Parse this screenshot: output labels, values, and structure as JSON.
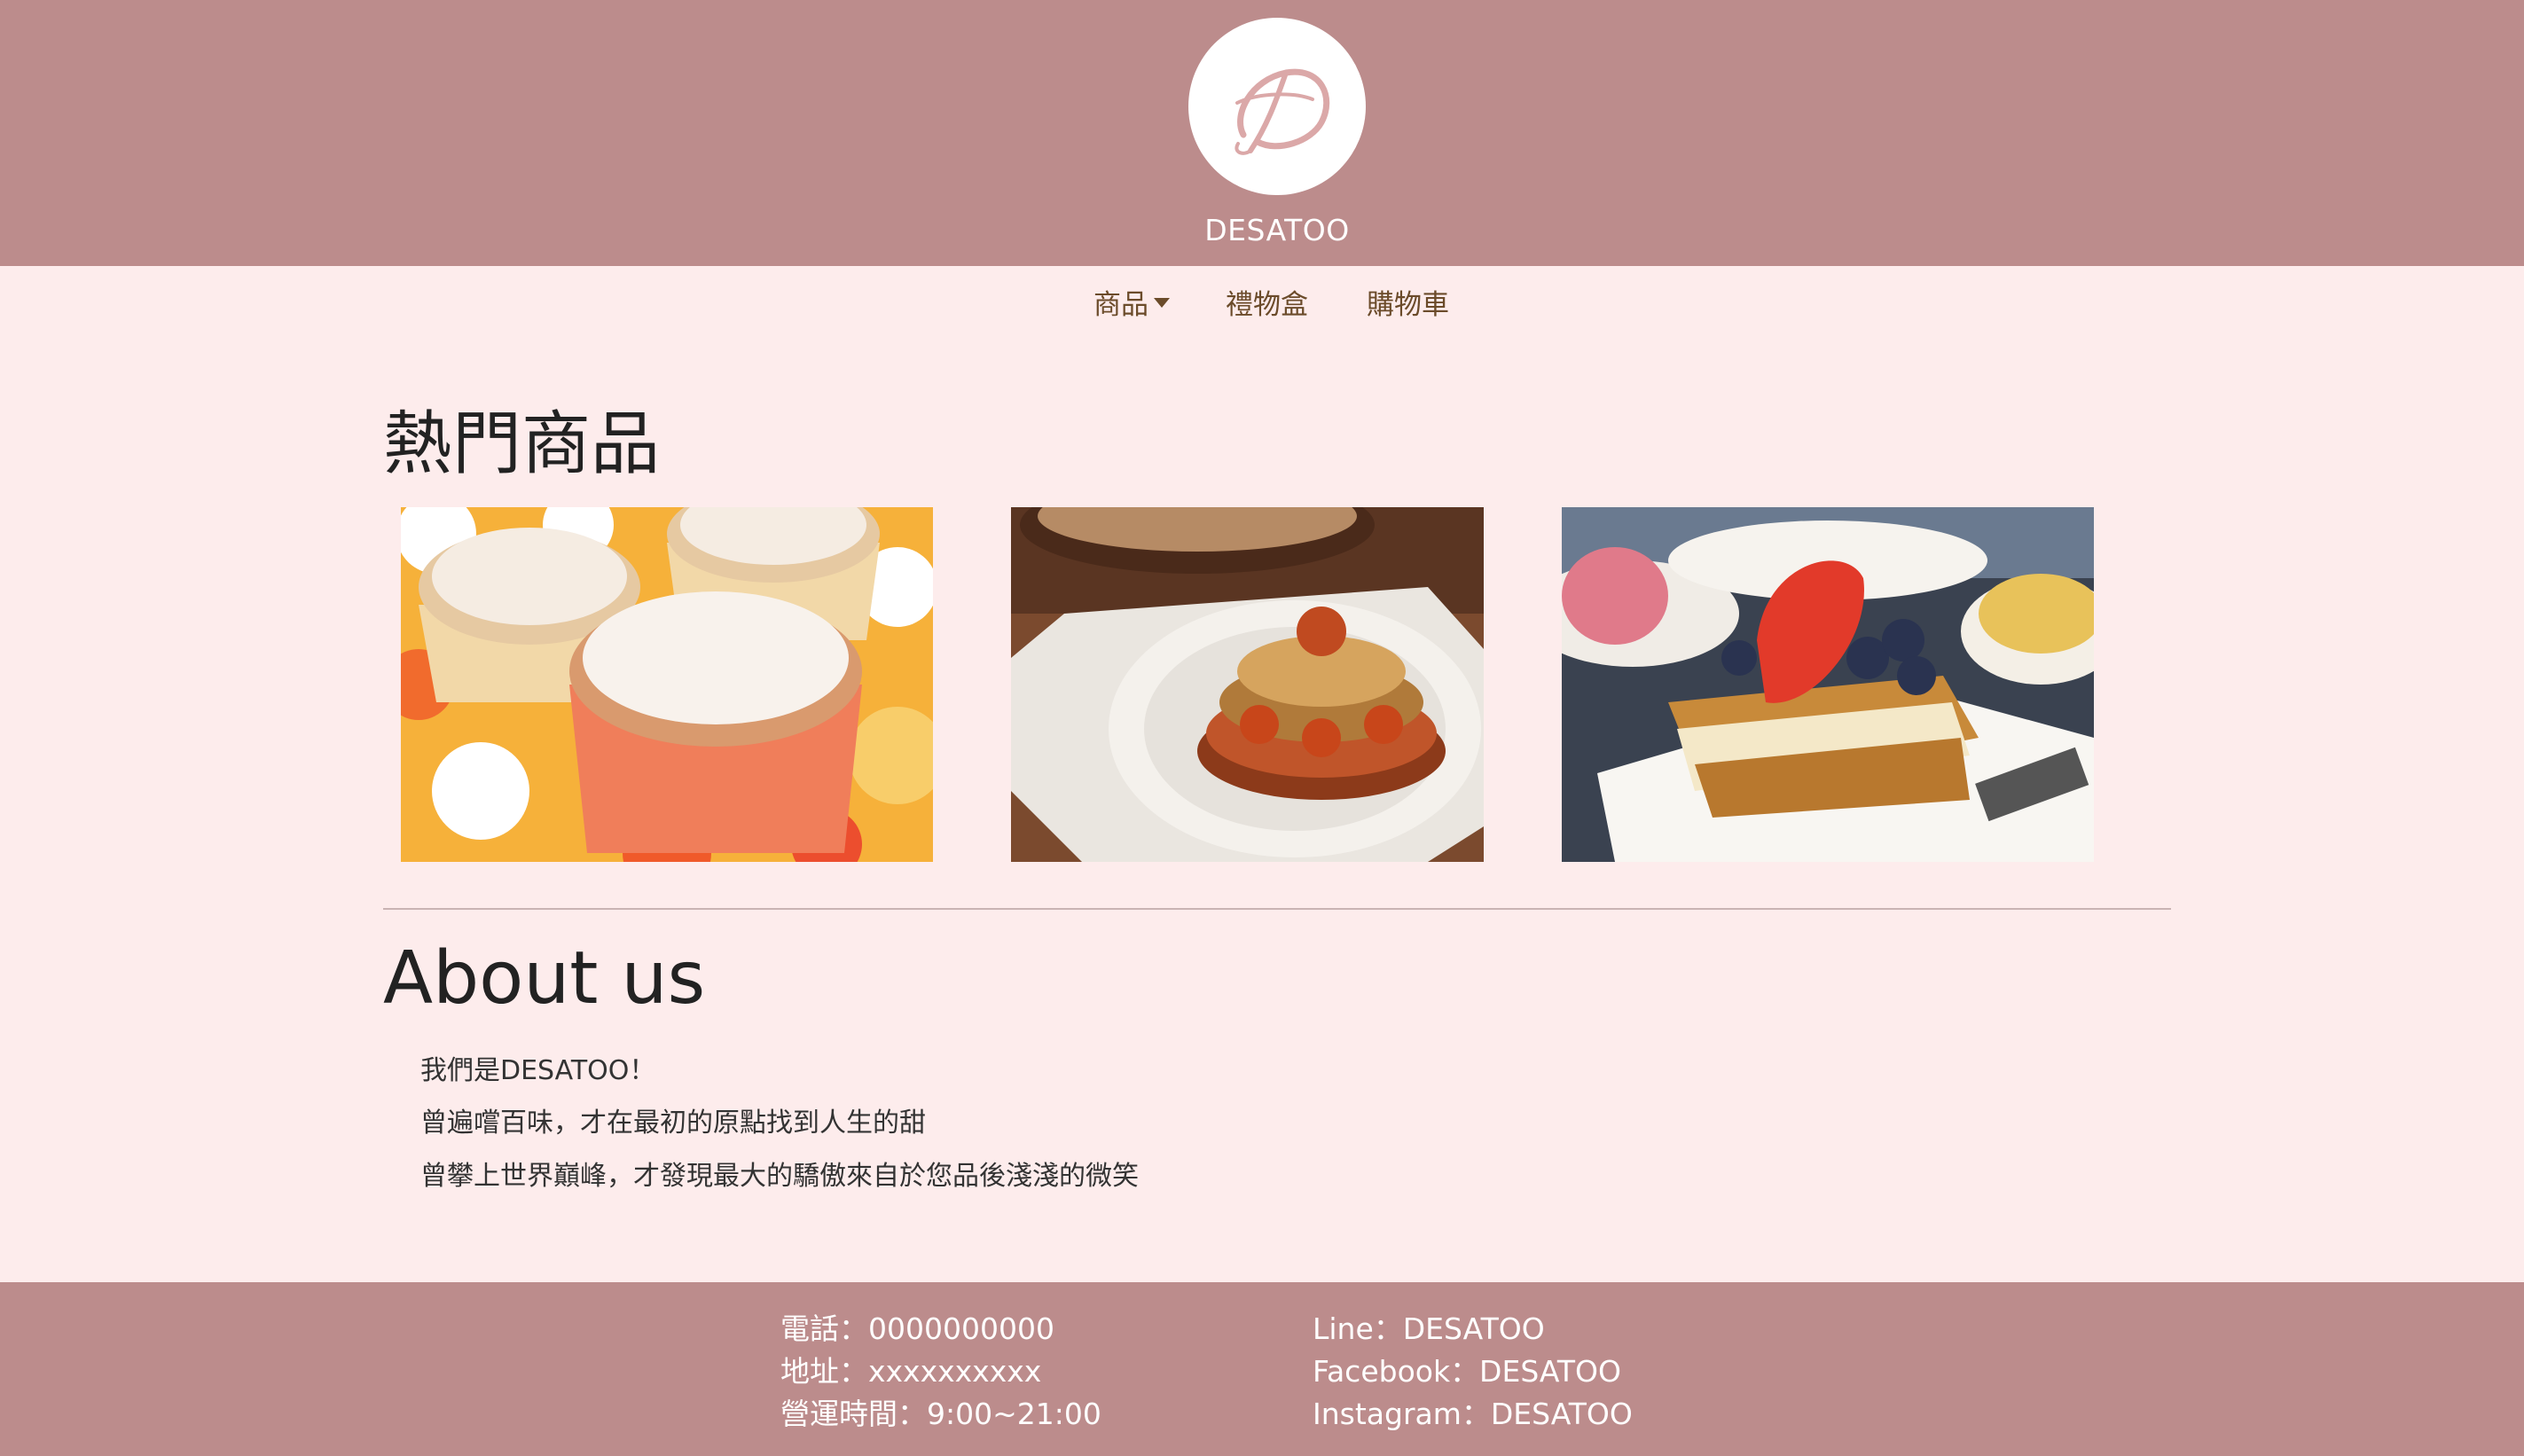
{
  "header": {
    "brand_name": "DESATOO",
    "logo_letter": "D",
    "background_color": "#bc8c8c"
  },
  "nav": {
    "items": [
      {
        "label": "商品",
        "has_dropdown": true
      },
      {
        "label": "禮物盒",
        "has_dropdown": false
      },
      {
        "label": "購物車",
        "has_dropdown": false
      }
    ]
  },
  "hot_products": {
    "title": "熱門商品",
    "items": [
      {
        "name": "souffle-image"
      },
      {
        "name": "saint-honore-tart-image"
      },
      {
        "name": "strawberry-mille-feuille-image"
      }
    ]
  },
  "about": {
    "title": "About us",
    "lines": [
      "我們是DESATOO！",
      "曾遍嚐百味，才在最初的原點找到人生的甜",
      "曾攀上世界巔峰，才發現最大的驕傲來自於您品後淺淺的微笑"
    ]
  },
  "footer": {
    "phone": "電話：0000000000",
    "address": "地址：xxxxxxxxxx",
    "hours": "營運時間：9:00~21:00",
    "line": "Line：DESATOO",
    "facebook": "Facebook：DESATOO",
    "instagram": "Instagram：DESATOO"
  },
  "colors": {
    "accent": "#bc8c8c",
    "page_background": "#fdecec",
    "nav_text": "#6b4b2a"
  }
}
